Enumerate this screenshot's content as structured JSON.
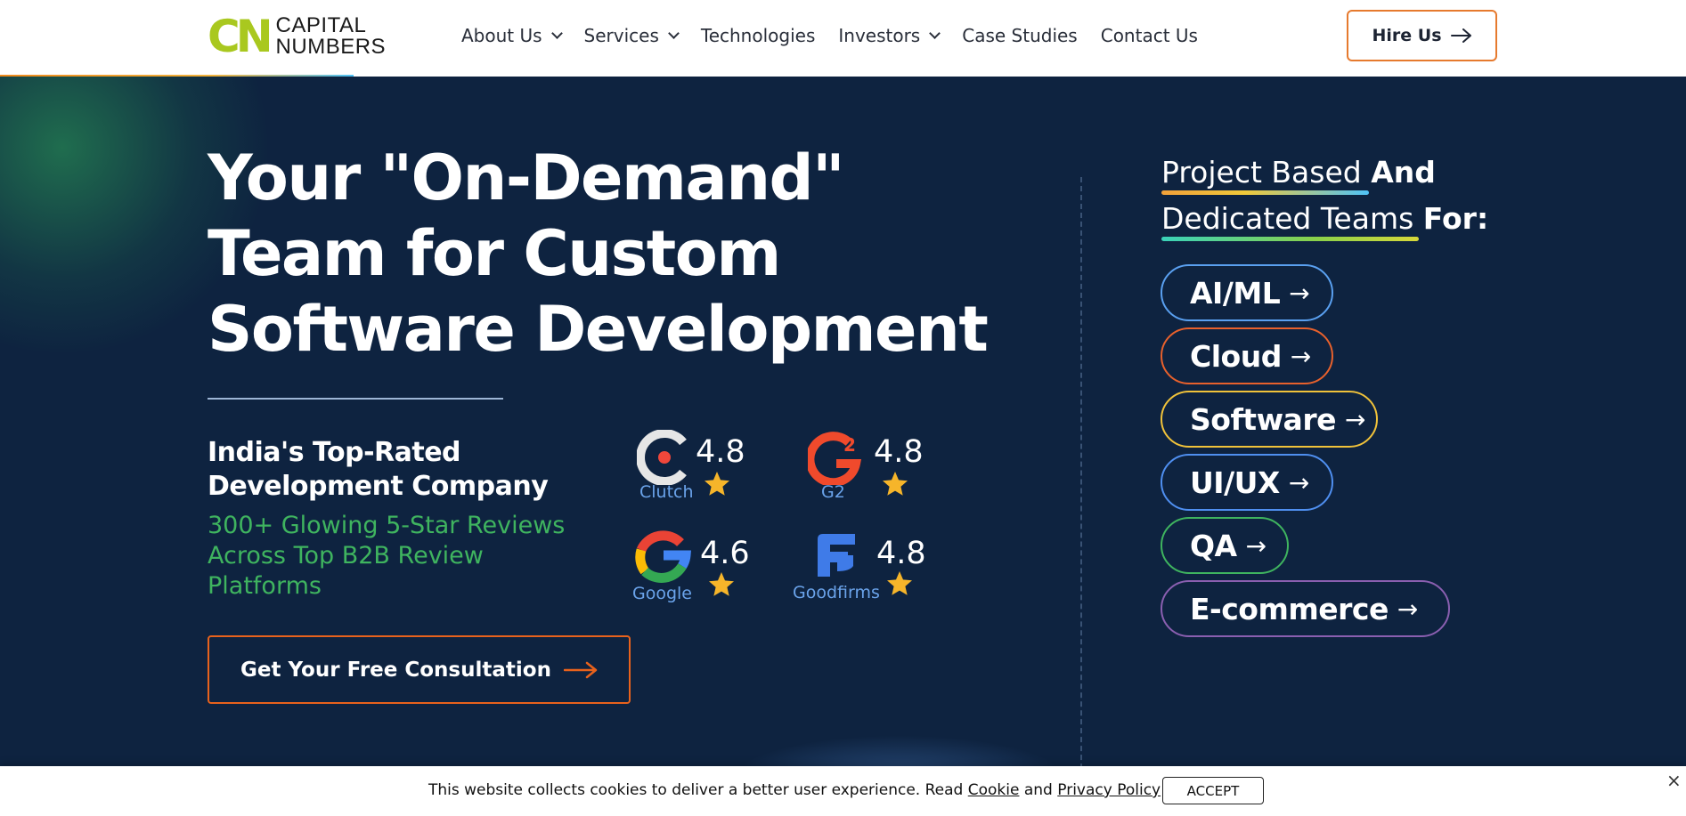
{
  "header": {
    "logo_mark": "CN",
    "logo_line1": "CAPITAL",
    "logo_line2": "NUMBERS",
    "nav": [
      {
        "label": "About Us",
        "dropdown": true
      },
      {
        "label": "Services",
        "dropdown": true
      },
      {
        "label": "Technologies",
        "dropdown": false
      },
      {
        "label": "Investors",
        "dropdown": true
      },
      {
        "label": "Case Studies",
        "dropdown": false
      },
      {
        "label": "Contact Us",
        "dropdown": false
      }
    ],
    "hire_label": "Hire Us"
  },
  "hero": {
    "headline": [
      "Your \"On-Demand\"",
      "Team for Custom",
      "Software Development"
    ],
    "subhead": [
      "India's Top-Rated",
      "Development Company"
    ],
    "green_text": "300+ Glowing 5-Star Reviews Across Top B2B Review Platforms",
    "cta_label": "Get Your Free Consultation"
  },
  "ratings": [
    {
      "platform": "Clutch",
      "score": "4.8",
      "logo": "clutch-logo-icon"
    },
    {
      "platform": "G2",
      "score": "4.8",
      "logo": "g2-logo-icon"
    },
    {
      "platform": "Google",
      "score": "4.6",
      "logo": "google-logo-icon"
    },
    {
      "platform": "Goodfirms",
      "score": "4.8",
      "logo": "goodfirms-logo-icon"
    }
  ],
  "teams": {
    "title_line1_light": "Project Based",
    "title_line1_bold": "And",
    "title_line2_light": "Dedicated Teams",
    "title_line2_bold": "For:",
    "items": [
      {
        "label": "AI/ML",
        "color": "#5aa0f0"
      },
      {
        "label": "Cloud",
        "color": "#e8612c"
      },
      {
        "label": "Software",
        "color": "#f0c23a"
      },
      {
        "label": "UI/UX",
        "color": "#4f8ff0"
      },
      {
        "label": "QA",
        "color": "#3fb45f"
      },
      {
        "label": "E-commerce",
        "color": "#8a5fb0"
      }
    ]
  },
  "cookie": {
    "text_pre": "This website collects cookies to deliver a better user experience. Read",
    "cookie_link": "Cookie",
    "and": "and",
    "privacy_link": "Privacy Policy",
    "accept_label": "ACCEPT",
    "close_glyph": "×"
  },
  "colors": {
    "background": "#0e2340",
    "accent_orange": "#e8621c",
    "green": "#3fb45f",
    "star": "#f6b52a"
  }
}
